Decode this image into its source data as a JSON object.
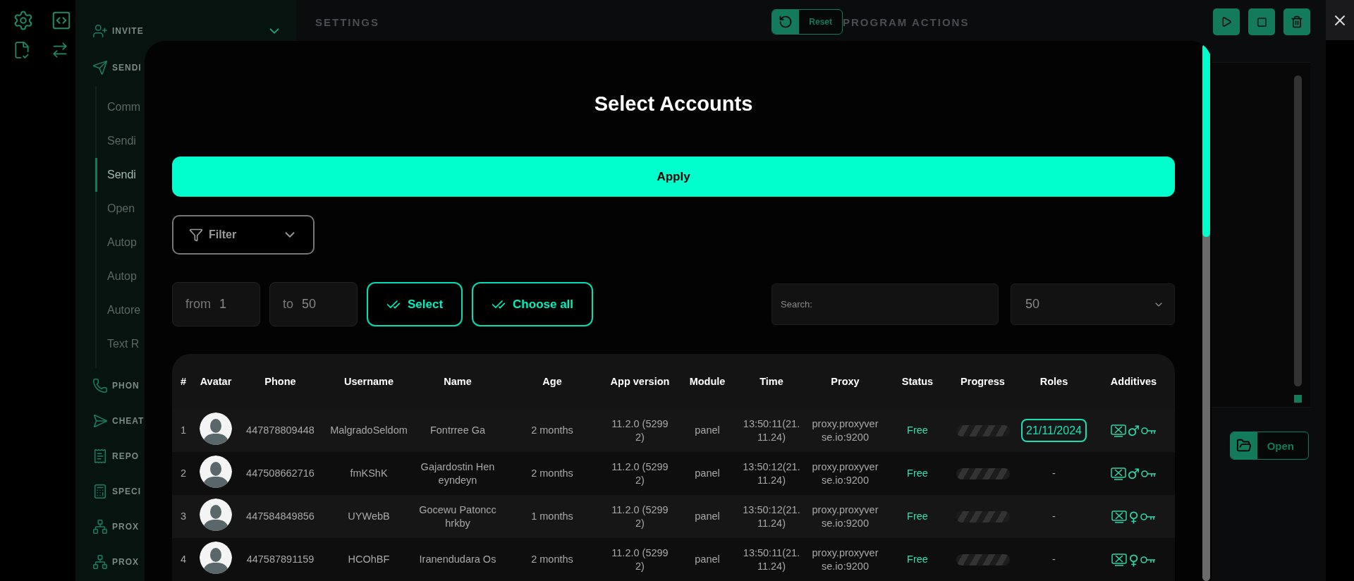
{
  "sidebar": {
    "sections": [
      {
        "label": "INVITE",
        "kind": "invite",
        "expanded": false
      },
      {
        "label": "SENDI",
        "kind": "send",
        "items": [
          {
            "label": "Comm",
            "selected": false
          },
          {
            "label": "Sendi",
            "selected": false
          },
          {
            "label": "Sendi",
            "selected": true
          },
          {
            "label": "Open",
            "selected": false
          },
          {
            "label": "Autop",
            "selected": false
          },
          {
            "label": "Autop",
            "selected": false
          },
          {
            "label": "Autore",
            "selected": false
          },
          {
            "label": "Text R",
            "selected": false
          }
        ]
      },
      {
        "label": "PHON",
        "kind": "phone"
      },
      {
        "label": "CHEAT",
        "kind": "cheat"
      },
      {
        "label": "REPO",
        "kind": "report"
      },
      {
        "label": "SPECI",
        "kind": "calc"
      },
      {
        "label": "PROX",
        "kind": "proxy"
      },
      {
        "label": "PROX",
        "kind": "proxy"
      }
    ]
  },
  "settings": {
    "title": "SETTINGS",
    "reset_label": "Reset"
  },
  "program_actions": {
    "title": "PROGRAM ACTIONS",
    "open_label": "Open"
  },
  "modal": {
    "title": "Select Accounts",
    "apply_label": "Apply",
    "filter_label": "Filter",
    "from": {
      "label": "from",
      "value": "1"
    },
    "to": {
      "label": "to",
      "value": "50"
    },
    "select_label": "Select",
    "choose_all_label": "Choose all",
    "search": {
      "placeholder": "Search:"
    },
    "page_size": "50",
    "table": {
      "columns": [
        "#",
        "Avatar",
        "Phone",
        "Username",
        "Name",
        "Age",
        "App version",
        "Module",
        "Time",
        "Proxy",
        "Status",
        "Progress",
        "Roles",
        "Additives"
      ],
      "rows": [
        {
          "index": "1",
          "phone": "447878809448",
          "username": "MalgradoSeldom",
          "name": "Fontrree Ga",
          "age": "2 months",
          "app_version": "11.2.0 (52992)",
          "module": "panel",
          "time": "13:50:11(21.11.24)",
          "proxy": "proxy.proxyverse.io:9200",
          "status": "Free",
          "progress": {
            "running": false
          },
          "roles": {
            "kind": "badge",
            "text": "21/11/2024"
          },
          "gender": "♂"
        },
        {
          "index": "2",
          "phone": "447508662716",
          "username": "fmKShK",
          "name": "Gajardostin Heneyndeyn",
          "age": "2 months",
          "app_version": "11.2.0 (52992)",
          "module": "panel",
          "time": "13:50:12(21.11.24)",
          "proxy": "proxy.proxyverse.io:9200",
          "status": "Free",
          "progress": {
            "running": false
          },
          "roles": {
            "kind": "plain",
            "text": "-"
          },
          "gender": "♂"
        },
        {
          "index": "3",
          "phone": "447584849856",
          "username": "UYWebB",
          "name": "Gocewu Patoncchrkby",
          "age": "1 months",
          "app_version": "11.2.0 (52992)",
          "module": "panel",
          "time": "13:50:12(21.11.24)",
          "proxy": "proxy.proxyverse.io:9200",
          "status": "Free",
          "progress": {
            "running": false
          },
          "roles": {
            "kind": "plain",
            "text": "-"
          },
          "gender": "♀"
        },
        {
          "index": "4",
          "phone": "447587891159",
          "username": "HCOhBF",
          "name": "Iranendudara Os",
          "age": "2 months",
          "app_version": "11.2.0 (52992)",
          "module": "panel",
          "time": "13:50:11(21.11.24)",
          "proxy": "proxy.proxyverse.io:9200",
          "status": "Free",
          "progress": {
            "running": false
          },
          "roles": {
            "kind": "plain",
            "text": "-"
          },
          "gender": "♀"
        }
      ]
    }
  }
}
